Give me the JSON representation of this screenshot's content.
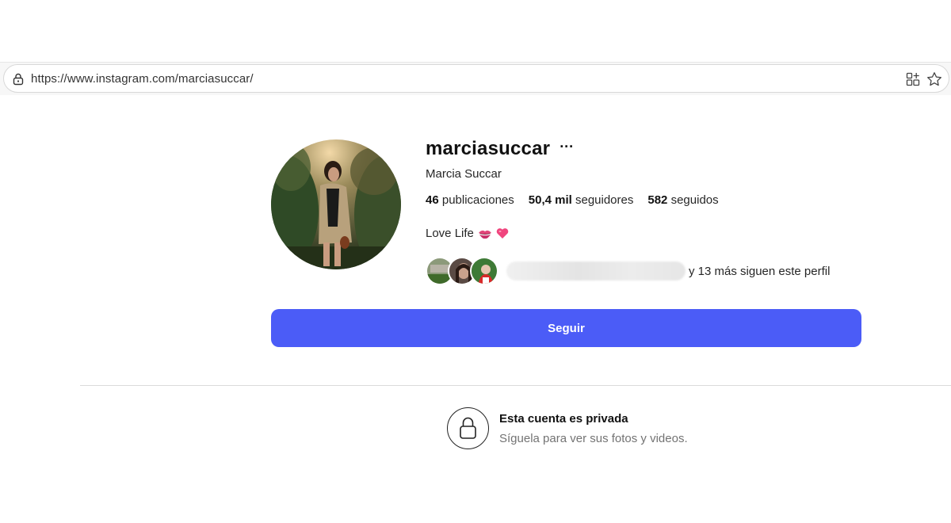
{
  "browser": {
    "url": "https://www.instagram.com/marciasuccar/"
  },
  "profile": {
    "username": "marciasuccar",
    "more_label": "···",
    "full_name": "Marcia Succar",
    "stats": {
      "posts_count": "46",
      "posts_label": "publicaciones",
      "followers_count": "50,4 mil",
      "followers_label": "seguidores",
      "following_count": "582",
      "following_label": "seguidos"
    },
    "bio": "Love Life",
    "bio_emojis": [
      "kiss-mark-icon",
      "heart-icon"
    ],
    "followed_by_text": "y 13 más siguen este perfil",
    "follow_button": "Seguir"
  },
  "private_notice": {
    "title": "Esta cuenta es privada",
    "subtitle": "Síguela para ver sus fotos y videos."
  },
  "colors": {
    "accent": "#4b5cf7",
    "muted_text": "#737373",
    "divider": "#dbdbdb"
  }
}
